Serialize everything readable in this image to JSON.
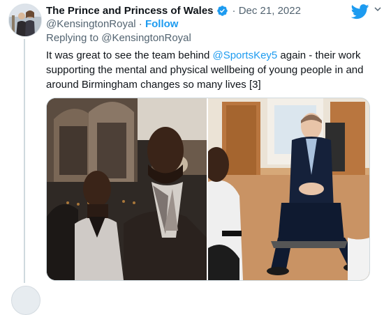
{
  "tweet": {
    "display_name": "The Prince and Princess of Wales",
    "date": "Dec 21, 2022",
    "handle": "@KensingtonRoyal",
    "separator": " · ",
    "follow_label": "Follow",
    "replying_prefix": "Replying to ",
    "replying_to": "@KensingtonRoyal",
    "text_before": "It was great to see the team behind ",
    "text_mention": "@SportsKey5",
    "text_after": " again - their work supporting the mental and physical wellbeing of young people in and around Birmingham changes so many lives [3]"
  },
  "colors": {
    "accent": "#1d9bf0",
    "secondary_text": "#536471",
    "primary_text": "#0f1419"
  },
  "icons": {
    "verified": "verified-badge-icon",
    "brand": "twitter-bird-icon"
  }
}
